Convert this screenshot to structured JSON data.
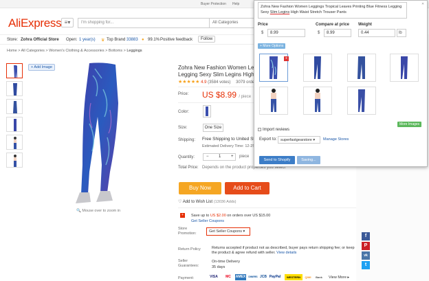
{
  "topbar": {
    "buyer_protection": "Buyer Protection",
    "help": "Help",
    "save_big": "Save big with our app!",
    "ship_to": "Ship to",
    "language": "English",
    "currency": "USD"
  },
  "header": {
    "logo": "AliExpress",
    "search_placeholder": "I'm shopping for...",
    "category": "All Categories",
    "menu_glyph": "≡▾",
    "brand_color": "#e62e04"
  },
  "store": {
    "label": "Store:",
    "name": "Zohra Official Store",
    "open": "Open:",
    "open_years": "1 year(s)",
    "top_brand": "Top Brand",
    "score": "33883",
    "positive": "99.1%",
    "positive_label": "Positive feedback",
    "follow": "Follow"
  },
  "breadcrumb": {
    "home": "Home",
    "c1": "All Categories",
    "c2": "Women's Clothing & Accessories",
    "c3": "Bottoms",
    "c4": "Leggings",
    "sep": " > "
  },
  "gallery": {
    "add_image": "+ Add Image",
    "zoom_text": "Mouse over to zoom in"
  },
  "product": {
    "title": "Zohra New Fashion Women Leggings",
    "title2": "Legging Sexy Slim Legins High Waist",
    "rating_stars": "★★★★★",
    "rating": "4.9",
    "votes": "(3584 votes)",
    "orders": "3079 orders",
    "price_label": "Price:",
    "price": "US $8.99",
    "price_unit": "/ piece",
    "color_label": "Color:",
    "size_label": "Size:",
    "size_value": "One Size",
    "shipping_label": "Shipping:",
    "shipping": "Free Shipping to United States",
    "delivery": "Estimated Delivery Time: 12-25 days",
    "qty_label": "Quantity:",
    "qty_minus": "−",
    "qty_value": "1",
    "qty_plus": "+",
    "qty_unit": "piece",
    "qty_available": "(4817 pieces available)",
    "total_label": "Total Price:",
    "total_text": "Depends on the product properties you select",
    "buy_now": "Buy Now",
    "add_to_cart": "Add to Cart",
    "wish": "Add to Wish List",
    "wish_count": "(13036 Adds)"
  },
  "coupon": {
    "icon": "+",
    "save_text": "Save up to",
    "save_amount": "US $2.00",
    "save_rest": " on orders over US $15.00",
    "get_link": "Get Seller Coupons",
    "promo_label": "Store Promotion:",
    "promo_button": "Get Seller Coupons ▾"
  },
  "policy": {
    "return_label": "Return Policy",
    "return_text": "Returns accepted if product not as described, buyer pays return shipping fee; or keep the product & agree refund with seller.",
    "view_details": "View details",
    "guarantee_label": "Seller Guarantees:",
    "on_time": "On-time Delivery",
    "days": "35 days",
    "payment_label": "Payment:",
    "view_more": "View More"
  },
  "payments": [
    "VISA",
    "MC",
    "AMEX",
    "DINERS",
    "JCB",
    "PayPal",
    "WESTERN",
    "QIWI",
    "Bank"
  ],
  "social": [
    "f",
    "P",
    "vk",
    "t"
  ],
  "popup": {
    "title_text": "Zohra New Fashion Women Leggings Tropical Leaves Printing Blue Fitness Legging Sexy",
    "title_underlined": "Slim Legins",
    "title_end": " High Waist Stretch Trouser Pants",
    "price_hdr": "Price",
    "compare_hdr": "Compare at price",
    "weight_hdr": "Weight",
    "price_cur": "$",
    "price_val": "8.99",
    "compare_cur": "$",
    "compare_val": "8.99",
    "weight_val": "0.44",
    "weight_unit": "lb",
    "more_options": "+ More Options",
    "remove_icon": "x",
    "more_images": "More Images",
    "import_reviews": "Import reviews",
    "export_to": "Export to:",
    "store": "superfastgearstore",
    "manage_stores": "Manage Stores",
    "send": "Send to Shopify",
    "saving": "Saving..."
  }
}
